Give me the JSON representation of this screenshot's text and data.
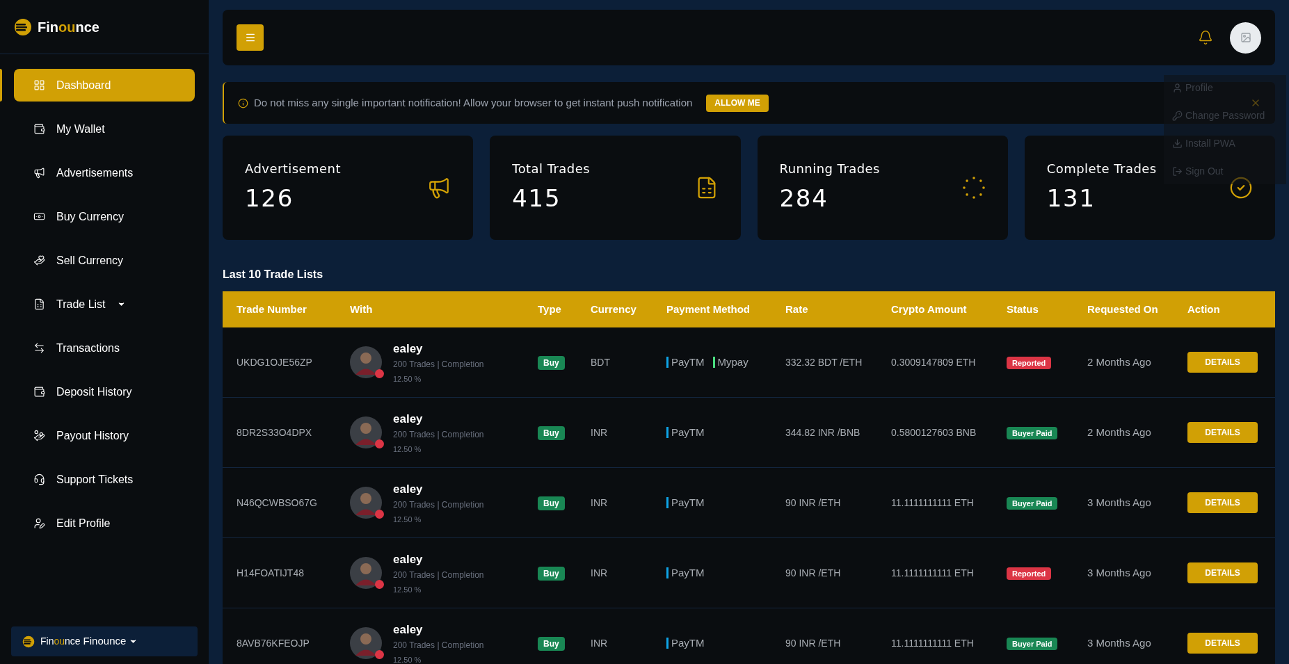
{
  "sidebar": {
    "logo": [
      {
        "text": "Fin",
        "accent": false
      },
      {
        "text": "ou",
        "accent": true
      },
      {
        "text": "nce",
        "accent": false
      }
    ],
    "items": [
      {
        "label": "Dashboard",
        "selected": true,
        "has_submenu": false
      },
      {
        "label": "My Wallet",
        "selected": false,
        "has_submenu": false
      },
      {
        "label": "Advertisements",
        "selected": false,
        "has_submenu": false
      },
      {
        "label": "Buy Currency",
        "selected": false,
        "has_submenu": false
      },
      {
        "label": "Sell Currency",
        "selected": false,
        "has_submenu": false
      },
      {
        "label": "Trade List",
        "selected": false,
        "has_submenu": true
      },
      {
        "label": "Transactions",
        "selected": false,
        "has_submenu": false
      },
      {
        "label": "Deposit History",
        "selected": false,
        "has_submenu": false
      },
      {
        "label": "Payout History",
        "selected": false,
        "has_submenu": false
      },
      {
        "label": "Support Tickets",
        "selected": false,
        "has_submenu": false
      },
      {
        "label": "Edit Profile",
        "selected": false,
        "has_submenu": false
      }
    ],
    "account": {
      "logo": [
        {
          "text": "Fin",
          "accent": false
        },
        {
          "text": "ou",
          "accent": true
        },
        {
          "text": "nce",
          "accent": false
        }
      ],
      "name": "Finounce"
    }
  },
  "profile_menu": {
    "items": [
      {
        "label": "Profile"
      },
      {
        "label": "Change Password"
      },
      {
        "label": "Install PWA"
      },
      {
        "label": "Sign Out"
      }
    ]
  },
  "notification": {
    "text": "Do not miss any single important notification! Allow your browser to get instant push notification",
    "button": "ALLOW ME"
  },
  "stats": [
    {
      "title": "Advertisement",
      "value": "126"
    },
    {
      "title": "Total Trades",
      "value": "415"
    },
    {
      "title": "Running Trades",
      "value": "284"
    },
    {
      "title": "Complete Trades",
      "value": "131"
    }
  ],
  "table": {
    "title": "Last 10 Trade Lists",
    "columns": [
      "Trade Number",
      "With",
      "Type",
      "Currency",
      "Payment Method",
      "Rate",
      "Crypto Amount",
      "Status",
      "Requested On",
      "Action"
    ],
    "rows": [
      {
        "trade_number": "UKDG1OJE56ZP",
        "user": {
          "name": "ealey",
          "trades": "200 Trades | Completion",
          "completion": "12.50 %",
          "online": false
        },
        "type": {
          "label": "Buy",
          "kind": "buy"
        },
        "currency": "BDT",
        "payment_methods": [
          {
            "name": "PayTM",
            "color": "#0ea5e9"
          },
          {
            "name": "Mypay",
            "color": "#4ade80"
          }
        ],
        "rate": "332.32 BDT /ETH",
        "crypto_amount": "0.3009147809 ETH",
        "status": {
          "label": "Reported",
          "kind": "reported"
        },
        "requested_on": "2 Months Ago",
        "action": "DETAILS"
      },
      {
        "trade_number": "8DR2S33O4DPX",
        "user": {
          "name": "ealey",
          "trades": "200 Trades | Completion",
          "completion": "12.50 %",
          "online": false
        },
        "type": {
          "label": "Buy",
          "kind": "buy"
        },
        "currency": "INR",
        "payment_methods": [
          {
            "name": "PayTM",
            "color": "#0ea5e9"
          }
        ],
        "rate": "344.82 INR /BNB",
        "crypto_amount": "0.5800127603 BNB",
        "status": {
          "label": "Buyer Paid",
          "kind": "paid"
        },
        "requested_on": "2 Months Ago",
        "action": "DETAILS"
      },
      {
        "trade_number": "N46QCWBSO67G",
        "user": {
          "name": "ealey",
          "trades": "200 Trades | Completion",
          "completion": "12.50 %",
          "online": false
        },
        "type": {
          "label": "Buy",
          "kind": "buy"
        },
        "currency": "INR",
        "payment_methods": [
          {
            "name": "PayTM",
            "color": "#0ea5e9"
          }
        ],
        "rate": "90 INR /ETH",
        "crypto_amount": "11.1111111111 ETH",
        "status": {
          "label": "Buyer Paid",
          "kind": "paid"
        },
        "requested_on": "3 Months Ago",
        "action": "DETAILS"
      },
      {
        "trade_number": "H14FOATIJT48",
        "user": {
          "name": "ealey",
          "trades": "200 Trades | Completion",
          "completion": "12.50 %",
          "online": false
        },
        "type": {
          "label": "Buy",
          "kind": "buy"
        },
        "currency": "INR",
        "payment_methods": [
          {
            "name": "PayTM",
            "color": "#0ea5e9"
          }
        ],
        "rate": "90 INR /ETH",
        "crypto_amount": "11.1111111111 ETH",
        "status": {
          "label": "Reported",
          "kind": "reported"
        },
        "requested_on": "3 Months Ago",
        "action": "DETAILS"
      },
      {
        "trade_number": "8AVB76KFEOJP",
        "user": {
          "name": "ealey",
          "trades": "200 Trades | Completion",
          "completion": "12.50 %",
          "online": false
        },
        "type": {
          "label": "Buy",
          "kind": "buy"
        },
        "currency": "INR",
        "payment_methods": [
          {
            "name": "PayTM",
            "color": "#0ea5e9"
          }
        ],
        "rate": "90 INR /ETH",
        "crypto_amount": "11.1111111111 ETH",
        "status": {
          "label": "Buyer Paid",
          "kind": "paid"
        },
        "requested_on": "3 Months Ago",
        "action": "DETAILS"
      }
    ]
  }
}
